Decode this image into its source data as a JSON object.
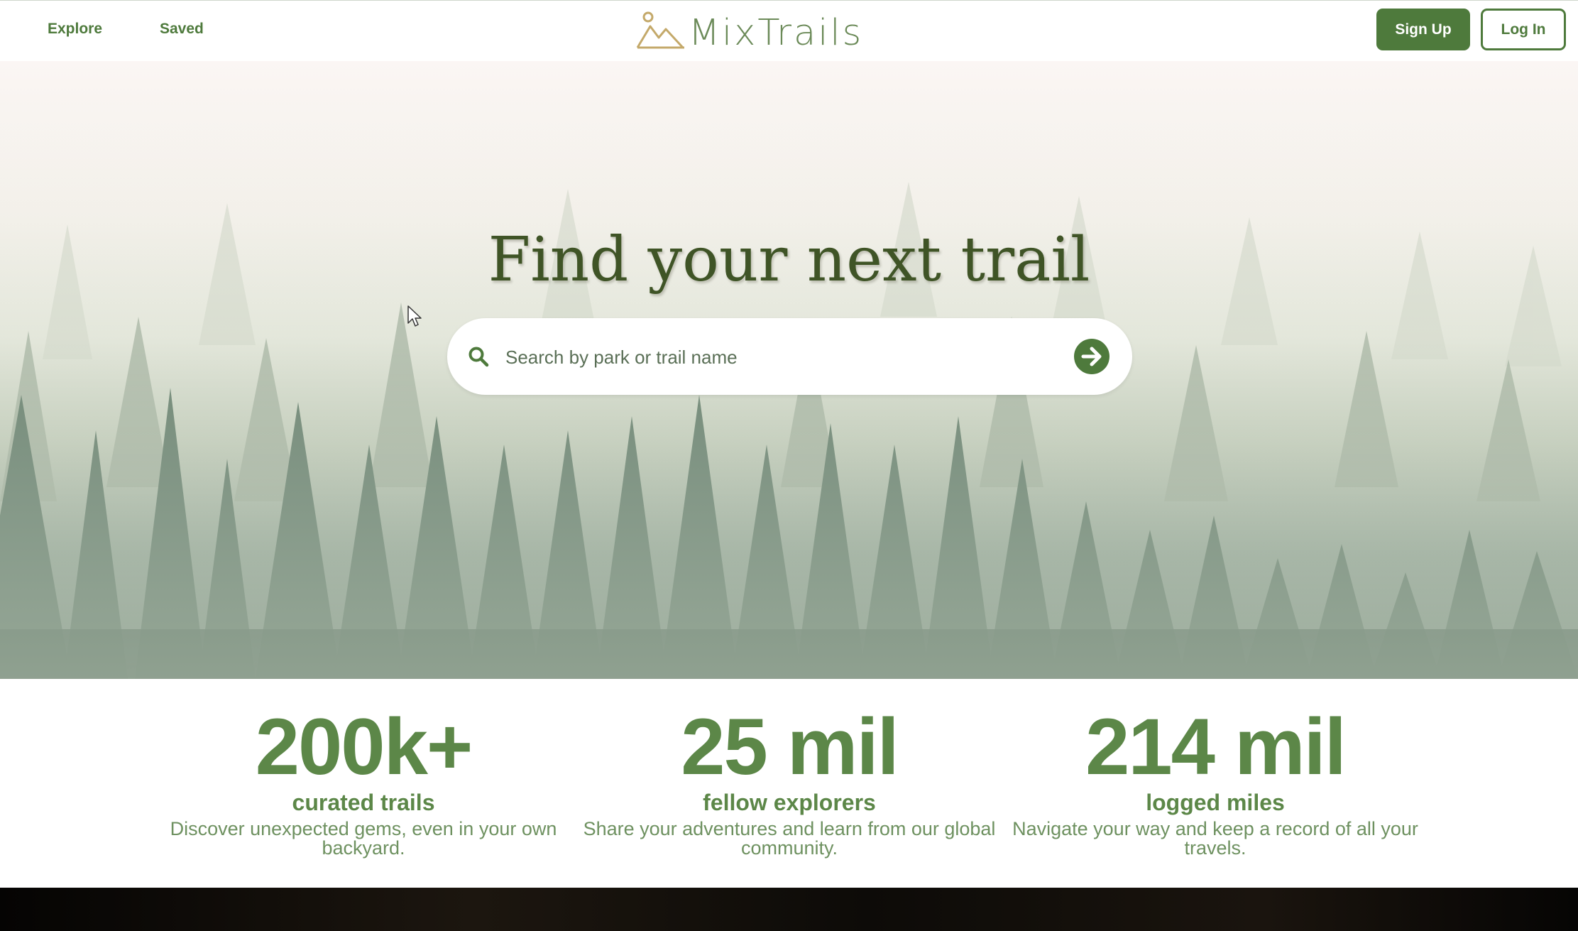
{
  "nav": {
    "links": [
      {
        "label": "Explore"
      },
      {
        "label": "Saved"
      }
    ],
    "logo_text": "MixTrails",
    "signup_label": "Sign Up",
    "login_label": "Log In"
  },
  "hero": {
    "title": "Find your next trail",
    "search": {
      "placeholder": "Search by park or trail name",
      "value": ""
    }
  },
  "stats": [
    {
      "value": "200k+",
      "label": "curated trails",
      "description": "Discover unexpected gems, even in your own backyard."
    },
    {
      "value": "25 mil",
      "label": "fellow explorers",
      "description": "Share your adventures and learn from our global community."
    },
    {
      "value": "214 mil",
      "label": "logged miles",
      "description": "Navigate your way and keep a record of all your travels."
    }
  ],
  "colors": {
    "primary": "#4e7a3c",
    "stat_green": "#5c8748",
    "title_green": "#3f5426",
    "logo_gold": "#c4a96a"
  },
  "icons": [
    "mountain-sun-logo-icon",
    "search-icon",
    "arrow-right-circle-icon",
    "mouse-cursor-icon"
  ]
}
